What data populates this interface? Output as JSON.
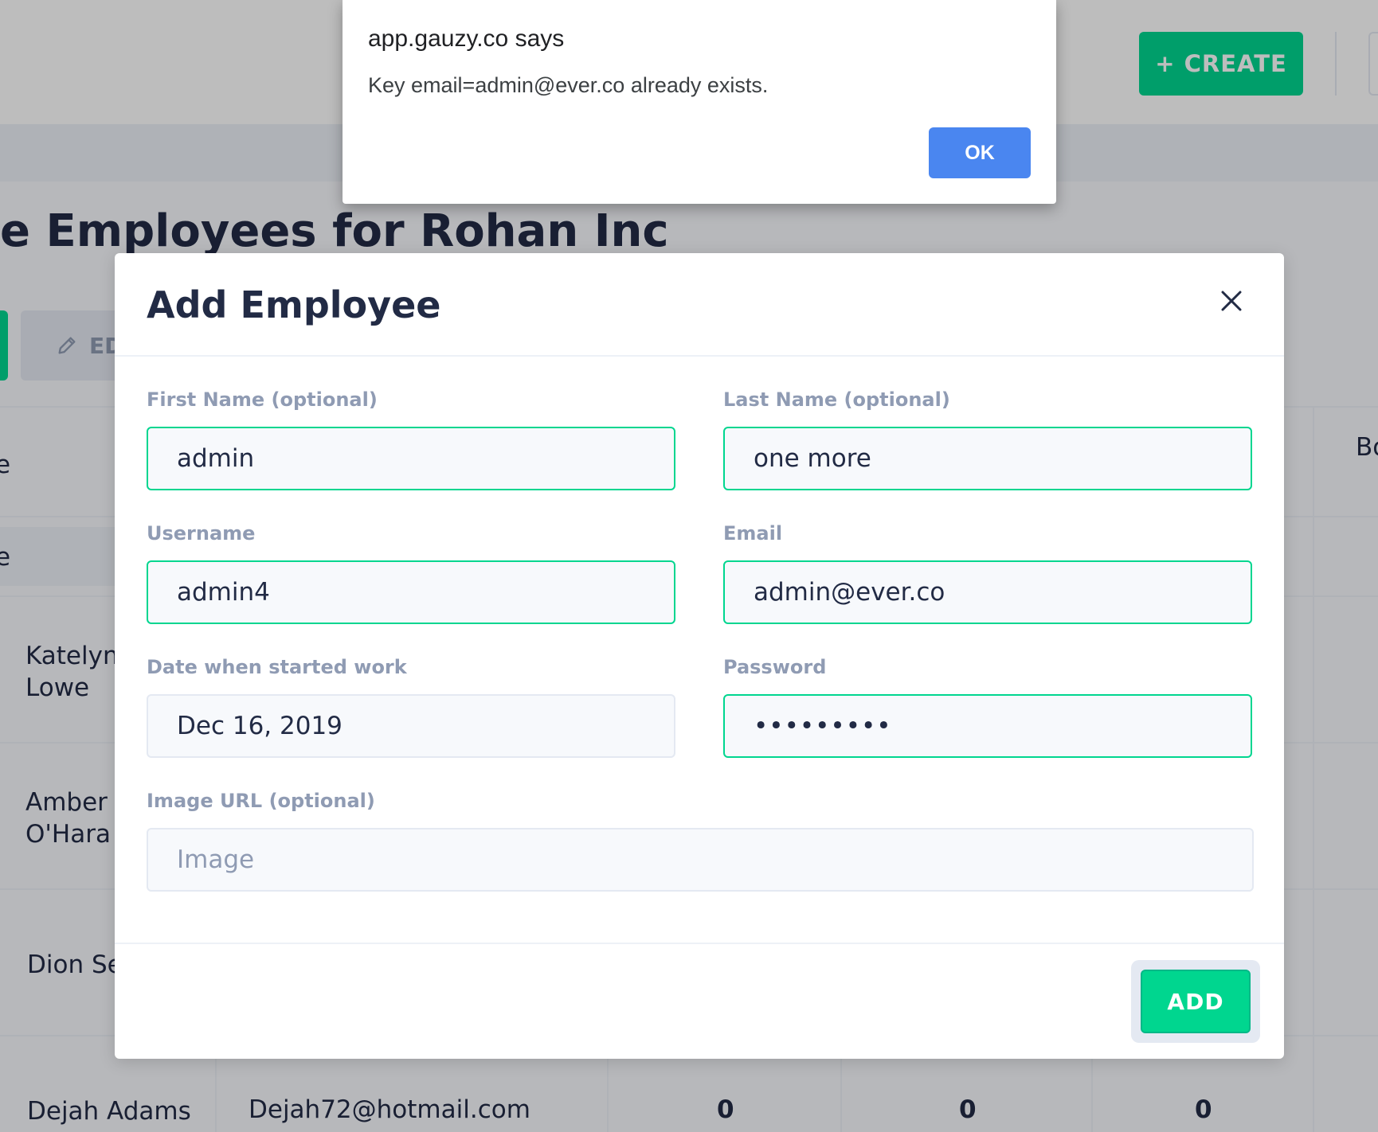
{
  "background": {
    "create_button": "+ CREATE",
    "page_title": "e Employees for Rohan Inc",
    "edit_button": "ED",
    "header_fragment_1": "e",
    "header_fragment_2": "e",
    "header_right_fragment": "Bo",
    "rows": [
      {
        "name": "Katelynn\nLowe"
      },
      {
        "name": "Amber\nO'Hara"
      },
      {
        "name": "Dion Se"
      },
      {
        "name": "Dejah Adams",
        "email": "Dejah72@hotmail.com",
        "col3": "0",
        "col4": "0",
        "col5": "0"
      }
    ]
  },
  "modal": {
    "title": "Add Employee",
    "first_name": {
      "label": "First Name (optional)",
      "value": "admin"
    },
    "last_name": {
      "label": "Last Name (optional)",
      "value": "one more"
    },
    "username": {
      "label": "Username",
      "value": "admin4"
    },
    "email": {
      "label": "Email",
      "value": "admin@ever.co"
    },
    "start_date": {
      "label": "Date when started work",
      "value": "Dec 16, 2019"
    },
    "password": {
      "label": "Password",
      "value": "•••••••••"
    },
    "image_url": {
      "label": "Image URL (optional)",
      "placeholder": "Image"
    },
    "add_button": "ADD"
  },
  "alert": {
    "title": "app.gauzy.co says",
    "message": "Key email=admin@ever.co already exists.",
    "ok_button": "OK"
  },
  "colors": {
    "success": "#00d68f",
    "primary_alert": "#4a86f0",
    "label": "#8f9bb3",
    "text": "#222b45"
  }
}
